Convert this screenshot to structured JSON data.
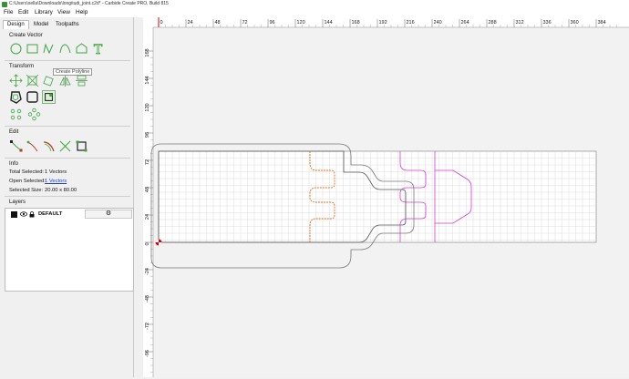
{
  "window": {
    "title": "C:\\Users\\sella\\Downloads\\longitudi_joint.c2d* - Carbide Create PRO, Build 815"
  },
  "menu": [
    "File",
    "Edit",
    "Library",
    "View",
    "Help"
  ],
  "tabs": [
    "Design",
    "Model",
    "Toolpaths"
  ],
  "sections": {
    "create_vector": "Create Vector",
    "transform": "Transform",
    "edit": "Edit",
    "info": "Info",
    "layers": "Layers"
  },
  "tooltip": "Create Polyline",
  "info": {
    "total_label": "Total Selected:",
    "total_value": "1 Vectors",
    "open_label": "Open Selected:",
    "open_value": "1 Vectors",
    "size_label": "Selected Size:",
    "size_value": "20.00 x 80.00"
  },
  "layers": [
    {
      "name": "DEFAULT"
    }
  ],
  "icons": {
    "create": [
      "circle-icon",
      "rectangle-icon",
      "polyline-icon",
      "curve-icon",
      "polygon-icon",
      "text-icon"
    ],
    "transform": [
      "move-icon",
      "scale-icon",
      "rotate-icon",
      "mirror-icon",
      "align-icon"
    ],
    "transform2": [
      "offset-icon",
      "boolean-icon",
      "join-icon"
    ],
    "array": [
      "grid-array-icon",
      "circular-array-icon"
    ],
    "edit": [
      "node-edit-icon",
      "trim-icon",
      "fillet-icon",
      "cut-icon",
      "select-icon"
    ]
  },
  "colors": {
    "accent": "#3fa63f",
    "selected": "#e07020",
    "guide": "#d040d0",
    "origin": "#dd0000"
  },
  "ruler": {
    "x_ticks": [
      0,
      24,
      48,
      72,
      96,
      120,
      144,
      168,
      192,
      216,
      240,
      264,
      288,
      312,
      336,
      360,
      384
    ],
    "y_ticks": [
      168,
      144,
      120,
      96,
      72,
      48,
      24,
      0,
      -24,
      -48,
      -72,
      -96
    ]
  }
}
